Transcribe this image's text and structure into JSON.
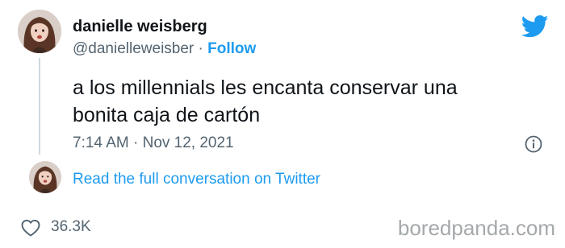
{
  "author": {
    "display_name": "danielle weisberg",
    "handle": "@danielleweisber",
    "separator": "·",
    "follow_label": "Follow"
  },
  "tweet": {
    "lines": [
      "a los millennials les encanta conservar una",
      "bonita caja de cartón"
    ],
    "timestamp": "7:14 AM · Nov 12, 2021"
  },
  "conversation": {
    "link_label": "Read the full conversation on Twitter"
  },
  "engagement": {
    "like_count": "36.3K"
  },
  "watermark": "boredpanda.com",
  "icons": {
    "brand": "twitter-bird-icon",
    "info": "info-icon",
    "like": "heart-icon"
  },
  "colors": {
    "accent": "#1d9bf0",
    "text": "#0f1419",
    "muted": "#536471",
    "thread_line": "#cfd9de",
    "watermark": "#a5a9ab"
  }
}
